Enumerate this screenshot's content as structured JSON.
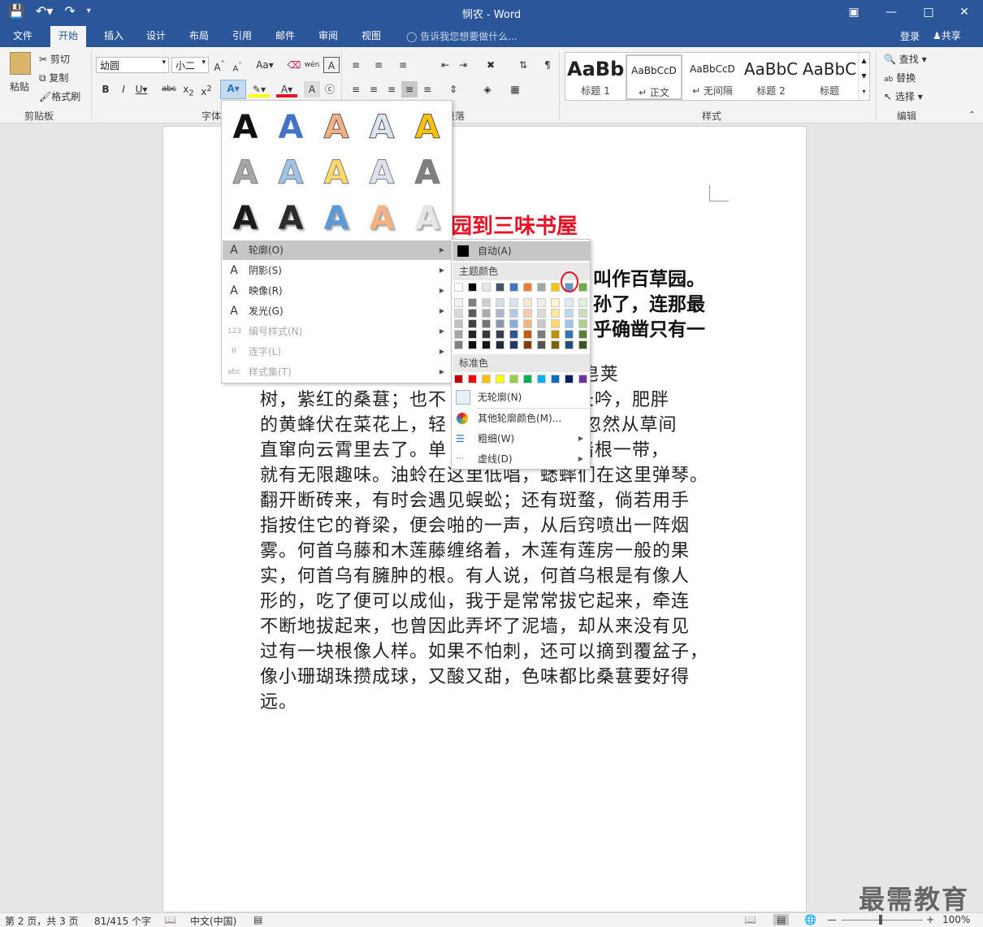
{
  "window": {
    "title": "悯农 - Word"
  },
  "tabs": [
    "文件",
    "开始",
    "插入",
    "设计",
    "布局",
    "引用",
    "邮件",
    "审阅",
    "视图"
  ],
  "tell_me": "告诉我您想要做什么...",
  "account": {
    "login": "登录",
    "share": "共享"
  },
  "clipboard": {
    "paste": "粘贴",
    "cut": "剪切",
    "copy": "复制",
    "format_painter": "格式刷",
    "group": "剪贴板"
  },
  "font": {
    "name": "幼圆",
    "size": "小二",
    "group": "字体"
  },
  "paragraph": {
    "group": "段落"
  },
  "styles": {
    "group": "样式",
    "items": [
      {
        "preview": "AaBb",
        "name": "标题 1"
      },
      {
        "preview": "AaBbCcD",
        "name": "↵ 正文"
      },
      {
        "preview": "AaBbCcD",
        "name": "↵ 无间隔"
      },
      {
        "preview": "AaBbC",
        "name": "标题 2"
      },
      {
        "preview": "AaBbC",
        "name": "标题"
      }
    ]
  },
  "editing": {
    "find": "查找",
    "replace": "替换",
    "select": "选择",
    "group": "编辑"
  },
  "text_effects_menu": {
    "effects": [
      {
        "glyph": "A",
        "color": "#111111"
      },
      {
        "glyph": "A",
        "color": "#4472c4"
      },
      {
        "glyph": "A",
        "color": "#f4b183"
      },
      {
        "glyph": "A",
        "color": "#dce6f2"
      },
      {
        "glyph": "A",
        "color": "#ffc000"
      },
      {
        "glyph": "A",
        "color": "#a6a6a6"
      },
      {
        "glyph": "A",
        "color": "#9dc3e6"
      },
      {
        "glyph": "A",
        "color": "#ffd966"
      },
      {
        "glyph": "A",
        "color": "#dde4f0"
      },
      {
        "glyph": "A",
        "color": "#7f7f7f"
      },
      {
        "glyph": "A",
        "color": "#1a1a1a"
      },
      {
        "glyph": "A",
        "color": "#2b2b2b"
      },
      {
        "glyph": "A",
        "color": "#5b9bd5"
      },
      {
        "glyph": "A",
        "color": "#f4b183"
      },
      {
        "glyph": "A",
        "color": "#e7e6e6"
      }
    ],
    "items": [
      {
        "label": "轮廓(O)",
        "icon": "A",
        "enabled": true
      },
      {
        "label": "阴影(S)",
        "icon": "A",
        "enabled": true
      },
      {
        "label": "映像(R)",
        "icon": "A",
        "enabled": true
      },
      {
        "label": "发光(G)",
        "icon": "A",
        "enabled": true
      },
      {
        "label": "编号样式(N)",
        "icon": "123",
        "enabled": false
      },
      {
        "label": "连字(L)",
        "icon": "fi",
        "enabled": false
      },
      {
        "label": "样式集(T)",
        "icon": "abc",
        "enabled": false
      }
    ]
  },
  "outline_submenu": {
    "auto": "自动(A)",
    "theme_colors_header": "主题颜色",
    "standard_colors_header": "标准色",
    "no_outline": "无轮廓(N)",
    "more_colors": "其他轮廓颜色(M)...",
    "weight": "粗细(W)",
    "dashes": "虚线(D)",
    "theme_top": [
      "#ffffff",
      "#000000",
      "#e7e6e6",
      "#44546a",
      "#4472c4",
      "#ed7d31",
      "#a5a5a5",
      "#ffc000",
      "#5b9bd5",
      "#70ad47"
    ],
    "theme_shades": [
      [
        "#f2f2f2",
        "#d9d9d9",
        "#bfbfbf",
        "#a6a6a6",
        "#808080"
      ],
      [
        "#808080",
        "#595959",
        "#404040",
        "#262626",
        "#0d0d0d"
      ],
      [
        "#d0cece",
        "#aeaaaa",
        "#757171",
        "#3a3838",
        "#171616"
      ],
      [
        "#d6dce4",
        "#adb9ca",
        "#8496b0",
        "#333f4f",
        "#222a35"
      ],
      [
        "#d9e2f3",
        "#b4c7e7",
        "#8eaadb",
        "#2f5597",
        "#1f3864"
      ],
      [
        "#fbe5d6",
        "#f8cbad",
        "#f4b183",
        "#c55a11",
        "#843c0c"
      ],
      [
        "#ededed",
        "#dbdbdb",
        "#c9c9c9",
        "#7b7b7b",
        "#525252"
      ],
      [
        "#fff2cc",
        "#ffe699",
        "#ffd966",
        "#bf9000",
        "#7f6000"
      ],
      [
        "#deebf7",
        "#bdd7ee",
        "#9dc3e6",
        "#2e75b6",
        "#1f4e79"
      ],
      [
        "#e2f0d9",
        "#c5e0b4",
        "#a9d18e",
        "#548235",
        "#375623"
      ]
    ],
    "standard": [
      "#c00000",
      "#ff0000",
      "#ffc000",
      "#ffff00",
      "#92d050",
      "#00b050",
      "#00b0f0",
      "#0070c0",
      "#002060",
      "#7030a0"
    ]
  },
  "document": {
    "title_visible": "园到三味书屋",
    "bold_lines": [
      "叫作百草园。",
      "孙了，连那最",
      "乎确凿只有一"
    ],
    "paragraph_lines": [
      "                                      ，高大的皂荚",
      "树，紫红的桑葚；也不                 里长吟，肥胖",
      "的黄蜂伏在菜花上，轻                 雀)忽然从草间",
      "直窜向云霄里去了。单                 泥墙根一带，",
      "就有无限趣味。油蛉在这里低唱，蟋蟀们在这里弹琴。",
      "翻开断砖来，有时会遇见蜈蚣；还有斑蝥，倘若用手",
      "指按住它的脊梁，便会啪的一声，从后窍喷出一阵烟",
      "雾。何首乌藤和木莲藤缠络着，木莲有莲房一般的果",
      "实，何首乌有臃肿的根。有人说，何首乌根是有像人",
      "形的，吃了便可以成仙，我于是常常拔它起来，牵连",
      "不断地拔起来，也曾因此弄坏了泥墙，却从来没有见",
      "过有一块根像人样。如果不怕刺，还可以摘到覆盆子，",
      "像小珊瑚珠攒成球，又酸又甜，色味都比桑葚要好得",
      "远。"
    ]
  },
  "status": {
    "page": "第 2 页，共 3 页",
    "words": "81/415 个字",
    "lang": "中文(中国)",
    "zoom": "100%"
  },
  "watermark": "最需教育"
}
